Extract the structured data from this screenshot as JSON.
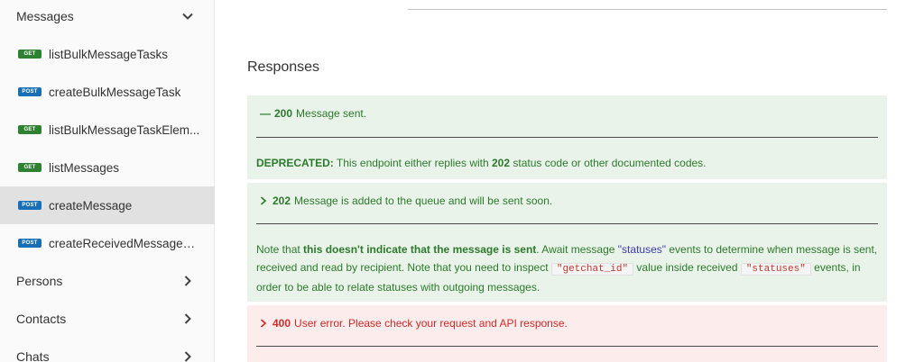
{
  "sidebar": {
    "sections": [
      {
        "label": "Messages",
        "expanded": true
      },
      {
        "label": "Persons",
        "expanded": false
      },
      {
        "label": "Contacts",
        "expanded": false
      },
      {
        "label": "Chats",
        "expanded": false
      }
    ],
    "items": [
      {
        "method": "GET",
        "label": "listBulkMessageTasks"
      },
      {
        "method": "POST",
        "label": "createBulkMessageTask"
      },
      {
        "method": "GET",
        "label": "listBulkMessageTaskElem..."
      },
      {
        "method": "GET",
        "label": "listMessages"
      },
      {
        "method": "POST",
        "label": "createMessage",
        "active": true
      },
      {
        "method": "POST",
        "label": "createReceivedMessageM..."
      }
    ]
  },
  "main": {
    "title": "Responses",
    "responses": [
      {
        "code": "200",
        "summary": "Message sent.",
        "deprecated_label": "DEPRECATED:",
        "deprecated_text_1": " This endpoint either replies with ",
        "deprecated_code": "202",
        "deprecated_text_2": " status code or other documented codes."
      },
      {
        "code": "202",
        "summary": "Message is added to the queue and will be sent soon.",
        "note_1": "Note that ",
        "note_bold": "this doesn't indicate that the message is sent",
        "note_2": ". Await message ",
        "note_link": "\"statuses\"",
        "note_3": " events to determine when message is sent, received and read by recipient. Note that you need to inspect ",
        "note_code_1": "\"getchat_id\"",
        "note_4": " value inside received ",
        "note_code_2": "\"statuses\"",
        "note_5": " events, in order to be able to relate statuses with outgoing messages."
      },
      {
        "code": "400",
        "summary": "User error. Please check your request and API response."
      }
    ]
  },
  "colors": {
    "get_badge": "#2f8132",
    "post_badge": "#186fb5",
    "success_bg": "#e9f3e9",
    "success_text": "#2c7a2c",
    "error_bg": "#fcecec",
    "error_text": "#d12a2a"
  }
}
